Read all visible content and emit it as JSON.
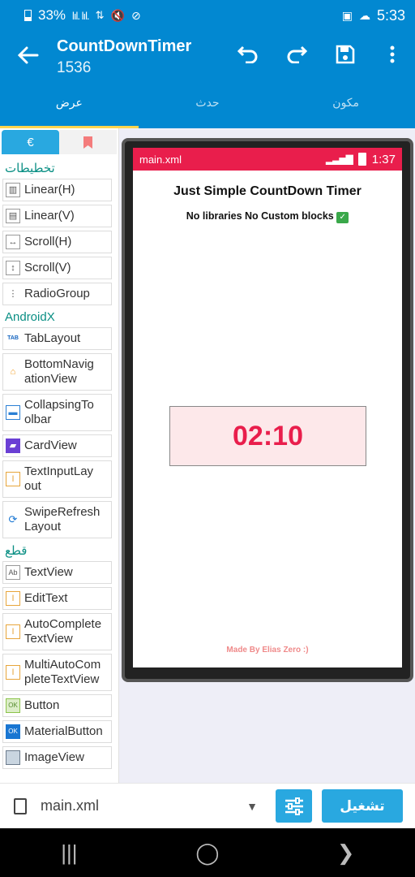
{
  "status_bar": {
    "battery": "33%",
    "time": "5:33"
  },
  "app_bar": {
    "title": "CountDownTimer",
    "subtitle": "1536"
  },
  "tabs": [
    {
      "label": "عرض"
    },
    {
      "label": "حدث"
    },
    {
      "label": "مكون"
    }
  ],
  "palette": {
    "tab_icon": "€",
    "sections": [
      {
        "title": "تخطيطات"
      },
      {
        "title": "AndroidX"
      },
      {
        "title": "قطع"
      }
    ],
    "layouts": [
      "Linear(H)",
      "Linear(V)",
      "Scroll(H)",
      "Scroll(V)",
      "RadioGroup"
    ],
    "androidx": [
      "TabLayout",
      "BottomNavigationView",
      "CollapsingToolbar",
      "CardView",
      "TextInputLayout",
      "SwipeRefreshLayout"
    ],
    "androidx_display": [
      [
        "TabLayout"
      ],
      [
        "BottomNavig",
        "ationView"
      ],
      [
        "CollapsingTo",
        "olbar"
      ],
      [
        "CardView"
      ],
      [
        "TextInputLay",
        "out"
      ],
      [
        "SwipeRefresh",
        "Layout"
      ]
    ],
    "widgets": [
      "TextView",
      "EditText",
      "AutoCompleteTextView",
      "MultiAutoCompleteTextView",
      "Button",
      "MaterialButton",
      "ImageView"
    ],
    "widgets_display": [
      [
        "TextView"
      ],
      [
        "EditText"
      ],
      [
        "AutoComplete",
        "TextView"
      ],
      [
        "MultiAutoCom",
        "pleteTextView"
      ],
      [
        "Button"
      ],
      [
        "MaterialButton"
      ],
      [
        "ImageView"
      ]
    ]
  },
  "preview": {
    "file_label": "main.xml",
    "time": "1:37",
    "title": "Just Simple CountDown Timer",
    "subtitle": "No libraries No Custom blocks",
    "timer": "02:10",
    "made_by": "Made By Elias Zero :)",
    "accent": "#e91e4c"
  },
  "bottom_bar": {
    "file": "main.xml",
    "run_label": "تشغيل"
  }
}
